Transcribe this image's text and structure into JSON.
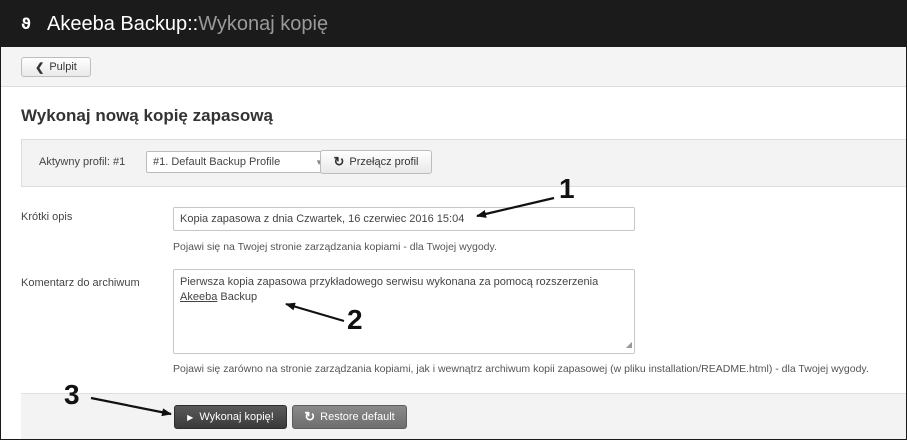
{
  "header": {
    "logo_glyph": "ϑ",
    "app_name": "Akeeba Backup",
    "separator": "::",
    "page_name": "Wykonaj kopię"
  },
  "toolbar": {
    "back_label": "Pulpit"
  },
  "main": {
    "title": "Wykonaj nową kopię zapasową",
    "profile": {
      "label": "Aktywny profil: #1",
      "selected": "#1. Default Backup Profile",
      "switch_label": "Przełącz profil"
    },
    "description": {
      "label": "Krótki opis",
      "value": "Kopia zapasowa z dnia Czwartek, 16 czerwiec 2016 15:04",
      "help": "Pojawi się na Twojej stronie zarządzania kopiami - dla Twojej wygody."
    },
    "comment": {
      "label": "Komentarz do archiwum",
      "value_line1": "Pierwsza kopia zapasowa przykładowego serwisu wykonana za pomocą rozszerzenia",
      "value_line2_link": "Akeeba",
      "value_line2_rest": " Backup",
      "help": "Pojawi się zarówno na stronie zarządzania kopiami, jak i wewnątrz archiwum kopii zapasowej (w pliku installation/README.html) - dla Twojej wygody."
    },
    "actions": {
      "backup_label": "Wykonaj kopię!",
      "restore_label": "Restore default"
    }
  },
  "annotations": {
    "one": "1",
    "two": "2",
    "three": "3"
  },
  "colors": {
    "header_bg": "#1b1b1b",
    "page_name": "#9a9a9a",
    "primary_button": "#444444",
    "secondary_button": "#7a7a7a"
  }
}
